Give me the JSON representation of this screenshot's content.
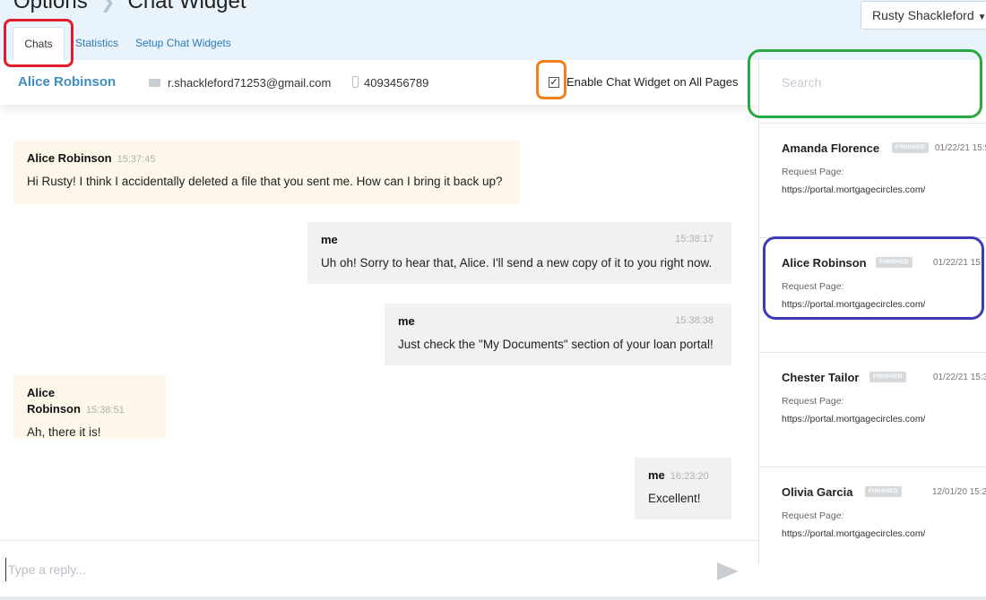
{
  "header": {
    "breadcrumb": [
      "Options",
      "Chat Widget"
    ],
    "user_select": "Rusty Shackleford",
    "tabs": [
      {
        "label": "Chats",
        "active": true
      },
      {
        "label": "Statistics",
        "active": false
      },
      {
        "label": "Setup Chat Widgets",
        "active": false
      }
    ]
  },
  "contact": {
    "name": "Alice Robinson",
    "email": "r.shackleford71253@gmail.com",
    "phone": "4093456789",
    "enable_widget_label": "Enable Chat Widget on All Pages",
    "enable_widget_checked": true
  },
  "messages": [
    {
      "sender": "Alice Robinson",
      "time": "15:37:45",
      "text": "Hi Rusty! I think I accidentally deleted a file that you sent me. How can I bring it back up?",
      "from_me": false
    },
    {
      "sender": "me",
      "time": "15:38:17",
      "text": "Uh oh! Sorry to hear that, Alice. I'll send a new copy of it to you right now.",
      "from_me": true
    },
    {
      "sender": "me",
      "time": "15:38:38",
      "text": "Just check the \"My Documents\" section of your loan portal!",
      "from_me": true
    },
    {
      "sender": "Alice Robinson",
      "time": "15:38:51",
      "text": "Ah, there it is!",
      "from_me": false
    },
    {
      "sender": "me",
      "time": "16:23:20",
      "text": "Excellent!",
      "from_me": true
    }
  ],
  "reply": {
    "placeholder": "Type a reply..."
  },
  "search": {
    "placeholder": "Search"
  },
  "chat_list": [
    {
      "name": "Amanda Florence",
      "status": "FINISHED",
      "date": "01/22/21 15:5",
      "label": "Request Page:",
      "url": "https://portal.mortgagecircles.com/"
    },
    {
      "name": "Alice Robinson",
      "status": "FINISHED",
      "date": "01/22/21 15:",
      "label": "Request Page:",
      "url": "https://portal.mortgagecircles.com/"
    },
    {
      "name": "Chester Tailor",
      "status": "FINISHED",
      "date": "01/22/21 15:3",
      "label": "Request Page:",
      "url": "https://portal.mortgagecircles.com/"
    },
    {
      "name": "Olivia Garcia",
      "status": "FINISHED",
      "date": "12/01/20 15:2",
      "label": "Request Page:",
      "url": "https://portal.mortgagecircles.com/"
    }
  ],
  "colors": {
    "header_bg": "#e9f3fb",
    "link": "#2a7ab8",
    "contact_name": "#3f8ec0",
    "their_bubble": "#fdf7ea",
    "my_bubble": "#f1f1f1",
    "highlight_red": "#e01e2b",
    "highlight_orange": "#f07f1e",
    "highlight_green": "#29a841",
    "highlight_blue": "#3e3cb5"
  }
}
